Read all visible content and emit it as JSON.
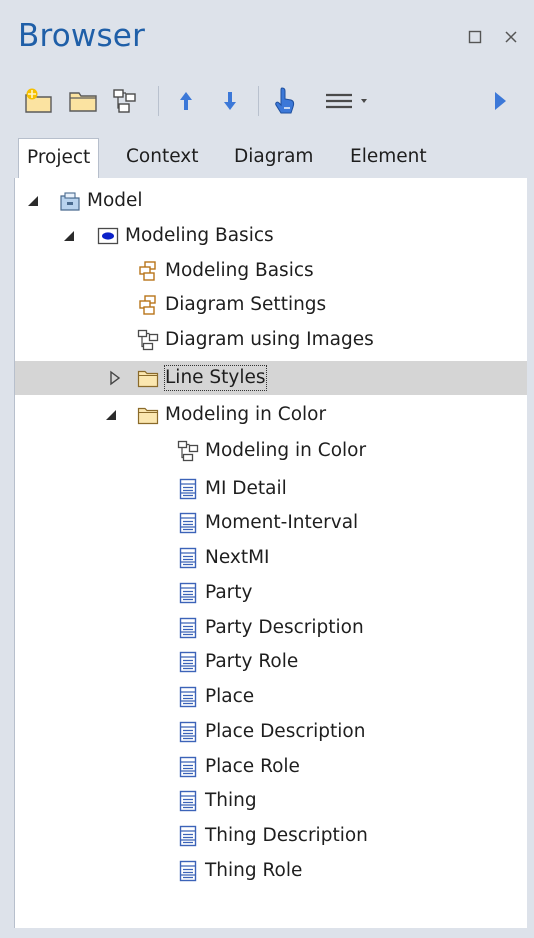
{
  "window": {
    "title": "Browser"
  },
  "tabs": [
    {
      "label": "Project",
      "active": true
    },
    {
      "label": "Context",
      "active": false
    },
    {
      "label": "Diagram",
      "active": false
    },
    {
      "label": "Element",
      "active": false
    }
  ],
  "tree": [
    {
      "label": "Model",
      "icon": "model-root-icon",
      "twisty": "expanded",
      "selected": false
    },
    {
      "label": "Modeling Basics",
      "icon": "view-package-icon",
      "twisty": "expanded",
      "selected": false
    },
    {
      "label": "Modeling Basics",
      "icon": "package-icon",
      "twisty": "none",
      "selected": false
    },
    {
      "label": "Diagram Settings",
      "icon": "package-icon",
      "twisty": "none",
      "selected": false
    },
    {
      "label": "Diagram using Images",
      "icon": "diagram-icon",
      "twisty": "none",
      "selected": false
    },
    {
      "label": "Line Styles",
      "icon": "folder-icon",
      "twisty": "collapsed",
      "selected": true
    },
    {
      "label": "Modeling in Color",
      "icon": "folder-icon",
      "twisty": "expanded",
      "selected": false
    },
    {
      "label": "Modeling in Color",
      "icon": "diagram-icon",
      "twisty": "none",
      "selected": false
    },
    {
      "label": "MI Detail",
      "icon": "class-icon",
      "twisty": "none",
      "selected": false
    },
    {
      "label": "Moment-Interval",
      "icon": "class-icon",
      "twisty": "none",
      "selected": false
    },
    {
      "label": "NextMI",
      "icon": "class-icon",
      "twisty": "none",
      "selected": false
    },
    {
      "label": "Party",
      "icon": "class-icon",
      "twisty": "none",
      "selected": false
    },
    {
      "label": "Party Description",
      "icon": "class-icon",
      "twisty": "none",
      "selected": false
    },
    {
      "label": "Party Role",
      "icon": "class-icon",
      "twisty": "none",
      "selected": false
    },
    {
      "label": "Place",
      "icon": "class-icon",
      "twisty": "none",
      "selected": false
    },
    {
      "label": "Place Description",
      "icon": "class-icon",
      "twisty": "none",
      "selected": false
    },
    {
      "label": "Place Role",
      "icon": "class-icon",
      "twisty": "none",
      "selected": false
    },
    {
      "label": "Thing",
      "icon": "class-icon",
      "twisty": "none",
      "selected": false
    },
    {
      "label": "Thing Description",
      "icon": "class-icon",
      "twisty": "none",
      "selected": false
    },
    {
      "label": "Thing Role",
      "icon": "class-icon",
      "twisty": "none",
      "selected": false
    }
  ],
  "colors": {
    "title": "#1f5fa8",
    "accent_blue": "#3c78d8",
    "folder": "#f2c14e",
    "selection": "#d5d5d5"
  }
}
